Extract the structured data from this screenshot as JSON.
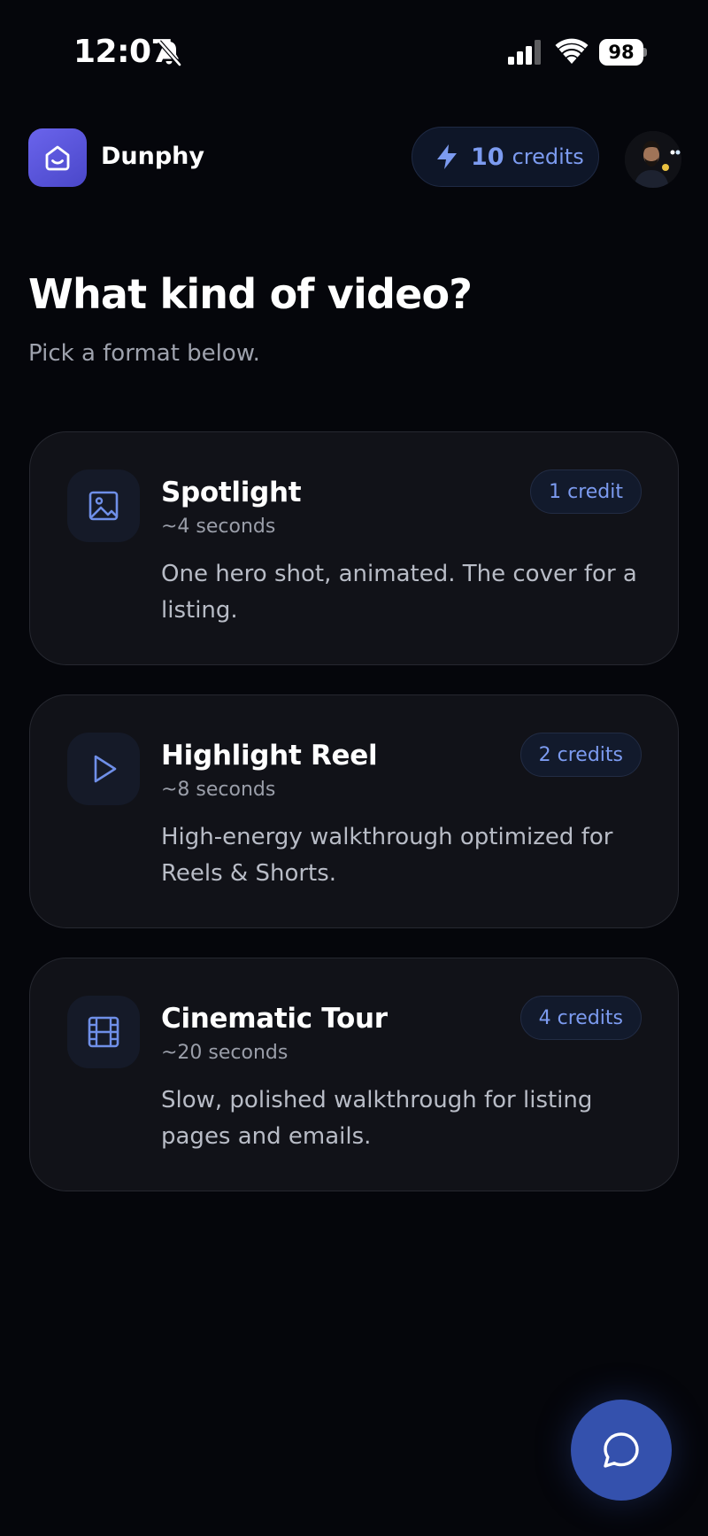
{
  "status_bar": {
    "time": "12:07",
    "battery": "98"
  },
  "header": {
    "brand": "Dunphy",
    "credits_count": "10",
    "credits_word": "credits"
  },
  "page": {
    "title": "What kind of video?",
    "subtitle": "Pick a format below."
  },
  "formats": [
    {
      "title": "Spotlight",
      "duration": "~4 seconds",
      "description": "One hero shot, animated. The cover for a listing.",
      "badge": "1 credit",
      "icon": "image-icon"
    },
    {
      "title": "Highlight Reel",
      "duration": "~8 seconds",
      "description": "High-energy walkthrough optimized for Reels & Shorts.",
      "badge": "2 credits",
      "icon": "play-icon"
    },
    {
      "title": "Cinematic Tour",
      "duration": "~20 seconds",
      "description": "Slow, polished walkthrough for listing pages and emails.",
      "badge": "4 credits",
      "icon": "film-icon"
    }
  ],
  "colors": {
    "background": "#05060b",
    "card": "#111218",
    "accent": "#7c9bf0",
    "brand": "#5a56db",
    "fab": "#3451ad"
  }
}
